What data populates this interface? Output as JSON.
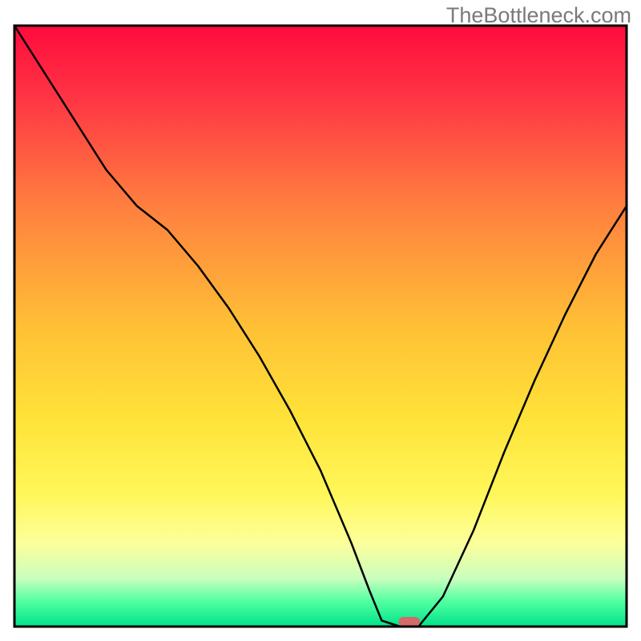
{
  "watermark": "TheBottleneck.com",
  "chart_data": {
    "type": "line",
    "title": "",
    "xlabel": "",
    "ylabel": "",
    "xlim": [
      0,
      100
    ],
    "ylim": [
      0,
      100
    ],
    "grid": false,
    "background_gradient": {
      "direction": "vertical",
      "stops": [
        {
          "offset": 0.0,
          "color": "#ff0b3d"
        },
        {
          "offset": 0.12,
          "color": "#ff3544"
        },
        {
          "offset": 0.3,
          "color": "#ff7f3f"
        },
        {
          "offset": 0.5,
          "color": "#ffc036"
        },
        {
          "offset": 0.65,
          "color": "#ffe238"
        },
        {
          "offset": 0.78,
          "color": "#fff75a"
        },
        {
          "offset": 0.86,
          "color": "#fdff9a"
        },
        {
          "offset": 0.92,
          "color": "#c9ffbe"
        },
        {
          "offset": 0.96,
          "color": "#4dffa0"
        },
        {
          "offset": 1.0,
          "color": "#00e28a"
        }
      ]
    },
    "series": [
      {
        "name": "bottleneck-curve",
        "stroke": "#000000",
        "stroke_width": 2.5,
        "x": [
          0,
          5,
          10,
          15,
          20,
          25,
          30,
          35,
          40,
          45,
          50,
          55,
          58,
          60,
          63,
          66,
          70,
          75,
          80,
          85,
          90,
          95,
          100
        ],
        "y": [
          100,
          92,
          84,
          76,
          70,
          66,
          60,
          53,
          45,
          36,
          26,
          14,
          6,
          1,
          0,
          0,
          5,
          16,
          29,
          41,
          52,
          62,
          70
        ]
      }
    ],
    "marker": {
      "name": "optimum-marker",
      "x": 64.5,
      "y": 0,
      "width": 3.5,
      "height": 1.6,
      "rx": 0.8,
      "color": "#d46a6a"
    },
    "frame": {
      "stroke": "#000000",
      "stroke_width": 3
    }
  }
}
